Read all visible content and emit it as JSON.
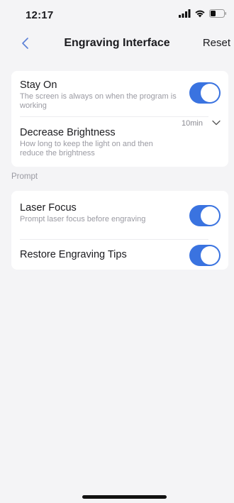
{
  "status_bar": {
    "time": "12:17",
    "icons": [
      "signal-icon",
      "wifi-icon",
      "battery-icon"
    ]
  },
  "nav": {
    "title": "Engraving Interface",
    "reset_label": "Reset",
    "back_icon": "chevron-left-icon"
  },
  "display_settings": {
    "stay_on": {
      "title": "Stay On",
      "description": "The screen is always on when the program is working",
      "enabled": true
    },
    "decrease_brightness": {
      "title": "Decrease Brightness",
      "description": "How long to keep the light on and then reduce the brightness",
      "value": "10min"
    }
  },
  "prompt_section": {
    "label": "Prompt",
    "laser_focus": {
      "title": "Laser Focus",
      "description": "Prompt laser focus before engraving",
      "enabled": true
    },
    "restore_tips": {
      "title": "Restore Engraving Tips",
      "enabled": true
    }
  },
  "colors": {
    "accent": "#3a73e0",
    "background": "#f4f4f6",
    "card": "#ffffff",
    "secondary_text": "#9a9aa2"
  }
}
